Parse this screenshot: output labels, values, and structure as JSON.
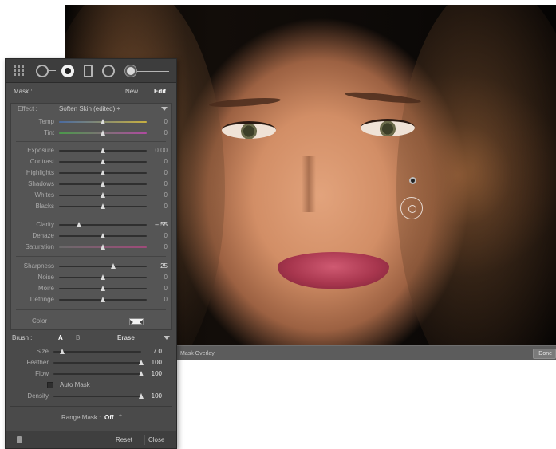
{
  "photo": {
    "overlay_label": "Mask Overlay",
    "done_label": "Done"
  },
  "tools": [
    "grid-tool",
    "spot-removal",
    "red-eye",
    "graduated-filter",
    "radial-filter",
    "adjustment-brush"
  ],
  "mask": {
    "label": "Mask :",
    "new_label": "New",
    "edit_label": "Edit"
  },
  "effect": {
    "label": "Effect :",
    "value": "Soften Skin (edited) ÷"
  },
  "sliders": {
    "temp": {
      "label": "Temp",
      "value": "0",
      "position": 0.5
    },
    "tint": {
      "label": "Tint",
      "value": "0",
      "position": 0.5
    },
    "exposure": {
      "label": "Exposure",
      "value": "0.00",
      "position": 0.5
    },
    "contrast": {
      "label": "Contrast",
      "value": "0",
      "position": 0.5
    },
    "highlights": {
      "label": "Highlights",
      "value": "0",
      "position": 0.5
    },
    "shadows": {
      "label": "Shadows",
      "value": "0",
      "position": 0.5
    },
    "whites": {
      "label": "Whites",
      "value": "0",
      "position": 0.5
    },
    "blacks": {
      "label": "Blacks",
      "value": "0",
      "position": 0.5
    },
    "clarity": {
      "label": "Clarity",
      "value": "– 55",
      "position": 0.23
    },
    "dehaze": {
      "label": "Dehaze",
      "value": "0",
      "position": 0.5
    },
    "saturation": {
      "label": "Saturation",
      "value": "0",
      "position": 0.5
    },
    "sharpness": {
      "label": "Sharpness",
      "value": "25",
      "position": 0.62
    },
    "noise": {
      "label": "Noise",
      "value": "0",
      "position": 0.5
    },
    "moire": {
      "label": "Moiré",
      "value": "0",
      "position": 0.5
    },
    "defringe": {
      "label": "Defringe",
      "value": "0",
      "position": 0.5
    }
  },
  "color": {
    "label": "Color"
  },
  "brush": {
    "label": "Brush :",
    "a_label": "A",
    "b_label": "B",
    "erase_label": "Erase",
    "size": {
      "label": "Size",
      "value": "7.0",
      "position": 0.1
    },
    "feather": {
      "label": "Feather",
      "value": "100",
      "position": 1.0
    },
    "flow": {
      "label": "Flow",
      "value": "100",
      "position": 1.0
    },
    "auto_mask_label": "Auto Mask",
    "density": {
      "label": "Density",
      "value": "100",
      "position": 1.0
    }
  },
  "range_mask": {
    "label": "Range Mask :",
    "value": "Off",
    "arrows": "÷"
  },
  "footer": {
    "reset_label": "Reset",
    "close_label": "Close"
  }
}
